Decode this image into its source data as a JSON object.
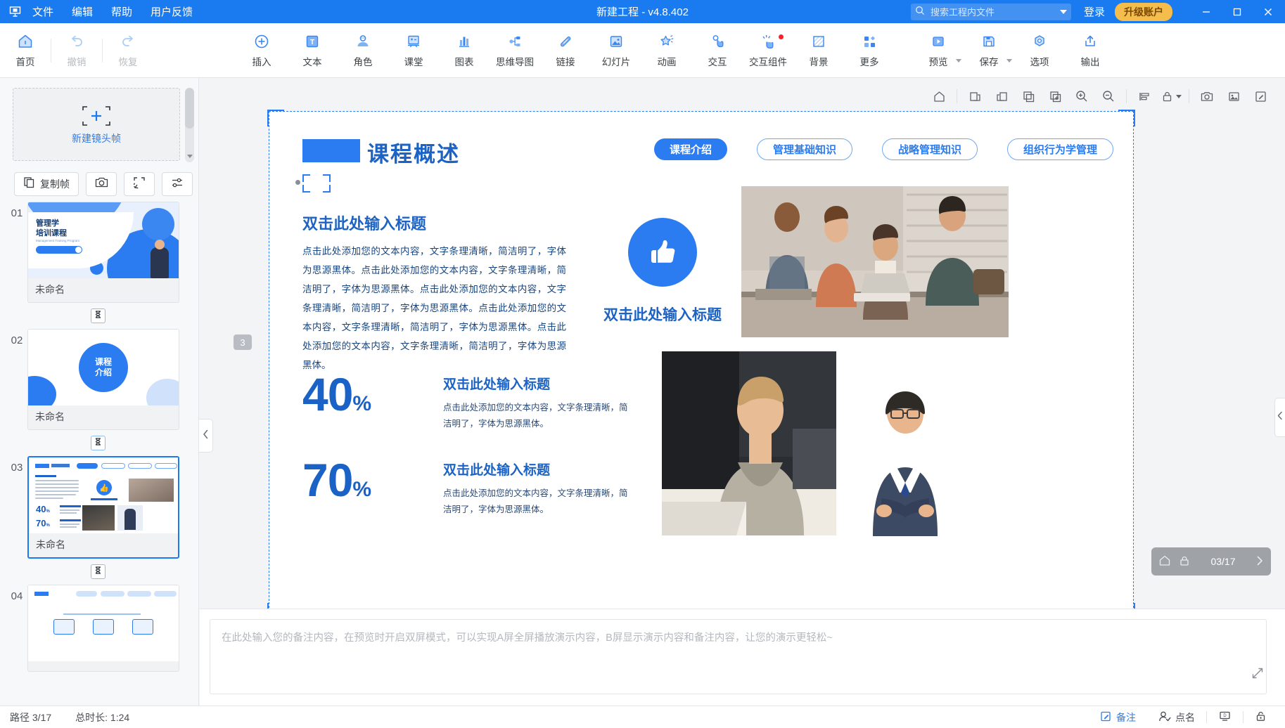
{
  "titlebar": {
    "logo_icon": "app-logo-icon",
    "menus": [
      "文件",
      "编辑",
      "帮助",
      "用户反馈"
    ],
    "title": "新建工程 - v4.8.402",
    "search_placeholder": "搜索工程内文件",
    "login_label": "登录",
    "upgrade_label": "升级账户",
    "window_buttons": [
      "minimize",
      "maximize",
      "close"
    ]
  },
  "toolbar": {
    "groupA": [
      {
        "label": "首页",
        "icon": "home-icon",
        "dim": false
      },
      {
        "label": "撤销",
        "icon": "undo-icon",
        "dim": true
      },
      {
        "label": "恢复",
        "icon": "redo-icon",
        "dim": true
      }
    ],
    "groupB": [
      {
        "label": "插入",
        "icon": "plus-circle-icon"
      },
      {
        "label": "文本",
        "icon": "text-box-icon"
      },
      {
        "label": "角色",
        "icon": "person-icon"
      },
      {
        "label": "课堂",
        "icon": "classroom-icon"
      },
      {
        "label": "图表",
        "icon": "bar-chart-icon"
      },
      {
        "label": "思维导图",
        "icon": "mindmap-icon"
      },
      {
        "label": "链接",
        "icon": "link-icon"
      },
      {
        "label": "幻灯片",
        "icon": "slide-image-icon"
      },
      {
        "label": "动画",
        "icon": "star-sparkle-icon"
      },
      {
        "label": "交互",
        "icon": "tap-hand-icon"
      },
      {
        "label": "交互组件",
        "icon": "click-burst-icon",
        "badge": true
      },
      {
        "label": "背景",
        "icon": "background-hatch-icon"
      },
      {
        "label": "更多",
        "icon": "grid-more-icon"
      }
    ],
    "groupC": [
      {
        "label": "预览",
        "icon": "play-icon",
        "caret": true
      },
      {
        "label": "保存",
        "icon": "save-disk-icon",
        "caret": true
      },
      {
        "label": "选项",
        "icon": "hex-gear-icon"
      },
      {
        "label": "输出",
        "icon": "export-upload-icon"
      }
    ]
  },
  "left_panel": {
    "new_frame_label": "新建镜头帧",
    "new_frame_icon": "add-frame-icon",
    "frame_tools": [
      {
        "label": "复制帧",
        "icon": "copy-frame-icon"
      },
      {
        "label": "",
        "icon": "camera-icon"
      },
      {
        "label": "",
        "icon": "fit-frame-icon"
      },
      {
        "label": "",
        "icon": "sort-sliders-icon"
      }
    ],
    "slides": [
      {
        "num": "01",
        "name": "未命名",
        "active": false
      },
      {
        "num": "02",
        "name": "未命名",
        "active": false
      },
      {
        "num": "03",
        "name": "未命名",
        "active": true
      },
      {
        "num": "04",
        "name": "",
        "active": false
      }
    ],
    "timing_icon": "hourglass-icon",
    "collapse_icon": "chevron-left-icon"
  },
  "canvas_toolbar": {
    "buttons": [
      {
        "icon": "home-outline-icon"
      },
      {
        "icon": "copy-left-icon"
      },
      {
        "icon": "copy-right-icon"
      },
      {
        "icon": "duplicate-icon"
      },
      {
        "icon": "duplicate-plus-icon"
      },
      {
        "icon": "zoom-in-icon"
      },
      {
        "icon": "zoom-out-icon"
      },
      {
        "icon": "align-icon"
      },
      {
        "icon": "lock-icon",
        "caret": true
      },
      {
        "icon": "snapshot-icon"
      },
      {
        "icon": "image-export-icon"
      },
      {
        "icon": "edit-pencil-icon"
      }
    ]
  },
  "slide": {
    "frame_badge": "3",
    "header_title": "课程概述",
    "tabs": [
      {
        "label": "课程介绍",
        "active": true
      },
      {
        "label": "管理基础知识",
        "active": false
      },
      {
        "label": "战略管理知识",
        "active": false
      },
      {
        "label": "组织行为学管理",
        "active": false
      }
    ],
    "body_title": "双击此处输入标题",
    "body_text": "点击此处添加您的文本内容，文字条理清晰，简洁明了，字体为思源黑体。点击此处添加您的文本内容，文字条理清晰，简洁明了，字体为思源黑体。点击此处添加您的文本内容，文字条理清晰，简洁明了，字体为思源黑体。点击此处添加您的文本内容，文字条理清晰，简洁明了，字体为思源黑体。点击此处添加您的文本内容，文字条理清晰，简洁明了，字体为思源黑体。",
    "thumbup_icon": "thumbs-up-icon",
    "thumbup_caption": "双击此处输入标题",
    "stats": [
      {
        "number": "40",
        "percent": "%",
        "title": "双击此处输入标题",
        "desc": "点击此处添加您的文本内容，文字条理清晰，简洁明了，字体为思源黑体。"
      },
      {
        "number": "70",
        "percent": "%",
        "title": "双击此处输入标题",
        "desc": "点击此处添加您的文本内容，文字条理清晰，简洁明了，字体为思源黑体。"
      }
    ],
    "playbar": {
      "home_icon": "home-icon",
      "lock_icon": "lock-icon",
      "page": "03/17",
      "next_icon": "chevron-right-icon"
    },
    "right_tab_icon": "chevron-left-icon"
  },
  "notes": {
    "placeholder": "在此处输入您的备注内容，在预览时开启双屏模式，可以实现A屏全屏播放演示内容，B屏显示演示内容和备注内容，让您的演示更轻松~",
    "expand_icon": "expand-arrows-icon"
  },
  "statusbar": {
    "path_label": "路径 3/17",
    "duration_label": "总时长: 1:24",
    "right_items": [
      {
        "label": "备注",
        "icon": "note-edit-icon",
        "accent": true
      },
      {
        "label": "点名",
        "icon": "roll-call-icon",
        "accent": false
      },
      {
        "label": "",
        "icon": "dual-screen-icon",
        "accent": false
      },
      {
        "label": "",
        "icon": "lock-small-icon",
        "accent": false
      }
    ]
  },
  "colors": {
    "brand_blue": "#1a7af0",
    "accent_blue": "#2b7cf0",
    "deep_blue": "#1c63c4",
    "upgrade_gold": "#f5bd4b",
    "badge_red": "#f5222d"
  }
}
